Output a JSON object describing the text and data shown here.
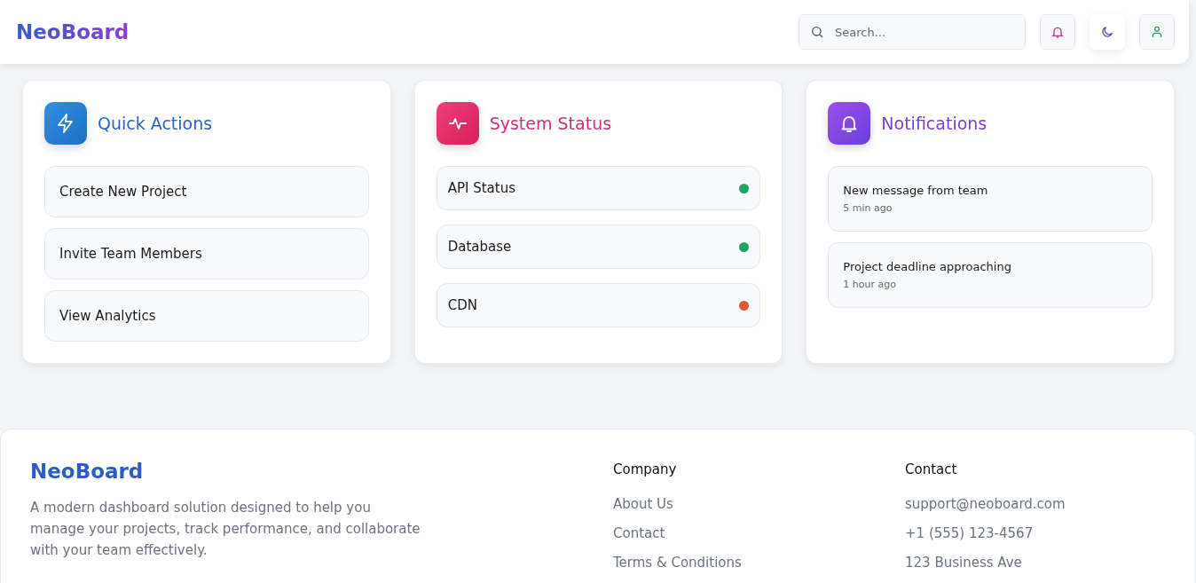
{
  "header": {
    "logo": "NeoBoard",
    "search": {
      "placeholder": "Search..."
    },
    "buttons": [
      {
        "kind": "bell"
      },
      {
        "kind": "theme"
      },
      {
        "kind": "user"
      }
    ]
  },
  "cards": [
    {
      "kind": "actions",
      "title": "Quick Actions",
      "items": [
        {
          "label": "Create New Project"
        },
        {
          "label": "Invite Team Members"
        },
        {
          "label": "View Analytics"
        }
      ]
    },
    {
      "kind": "status",
      "title": "System Status",
      "items": [
        {
          "label": "API Status",
          "color": "#1fa463"
        },
        {
          "label": "Database",
          "color": "#1fa463"
        },
        {
          "label": "CDN",
          "color": "#e4572e"
        }
      ]
    },
    {
      "kind": "notifications",
      "title": "Notifications",
      "items": [
        {
          "label": "New message from team",
          "time": "5 min ago"
        },
        {
          "label": "Project deadline approaching",
          "time": "1 hour ago"
        }
      ]
    }
  ],
  "footer": {
    "brand": "NeoBoard",
    "description": "A modern dashboard solution designed to help you manage your projects, track performance, and collaborate with your team effectively.",
    "columns": [
      {
        "title": "Company",
        "links": [
          "About Us",
          "Contact",
          "Terms & Conditions"
        ]
      },
      {
        "title": "Contact",
        "links": [
          "support@neoboard.com",
          "+1 (555) 123-4567",
          "123 Business Ave"
        ]
      }
    ]
  }
}
